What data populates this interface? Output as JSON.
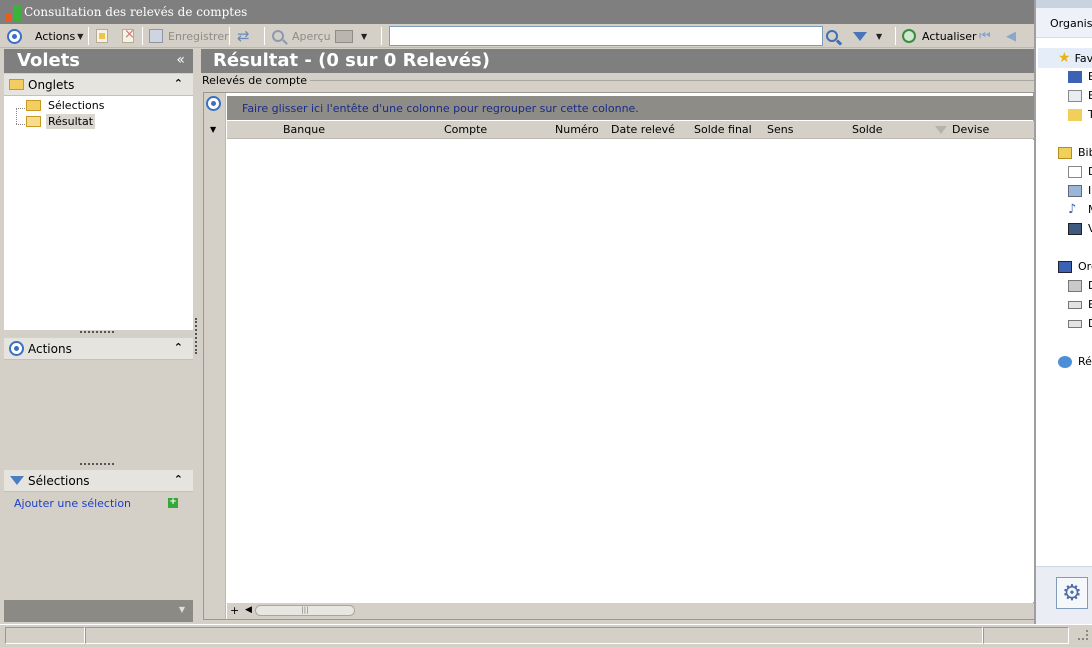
{
  "window": {
    "title": "Consultation des relevés de comptes"
  },
  "toolbar": {
    "actions_label": "Actions",
    "save_label": "Enregistrer",
    "preview_label": "Aperçu",
    "refresh_label": "Actualiser",
    "search_value": ""
  },
  "left": {
    "header_title": "Volets",
    "onglets": {
      "title": "Onglets",
      "items": [
        {
          "label": "Sélections"
        },
        {
          "label": "Résultat"
        }
      ]
    },
    "actions": {
      "title": "Actions"
    },
    "selections": {
      "title": "Sélections",
      "add_label": "Ajouter une sélection"
    }
  },
  "result": {
    "title": "Résultat - (0 sur 0 Relevés)",
    "group_label": "Relevés de compte",
    "group_hint": "Faire glisser ici l'entête d'une colonne pour regrouper sur cette colonne.",
    "columns": [
      "Banque",
      "Compte",
      "Numéro",
      "Date relevé",
      "Solde final",
      "Sens",
      "Solde",
      "Devise"
    ]
  },
  "explorer": {
    "organize_label": "Organiser",
    "items": [
      {
        "label": "Fav",
        "icon": "star-icon"
      },
      {
        "label": "B",
        "icon": "desktop-icon"
      },
      {
        "label": "E",
        "icon": "document-icon"
      },
      {
        "label": "T",
        "icon": "folder-icon"
      },
      {
        "label": "Bib",
        "icon": "library-icon"
      },
      {
        "label": "D",
        "icon": "document-icon"
      },
      {
        "label": "I",
        "icon": "picture-icon"
      },
      {
        "label": "M",
        "icon": "music-icon"
      },
      {
        "label": "V",
        "icon": "video-icon"
      },
      {
        "label": "Ord",
        "icon": "computer-icon"
      },
      {
        "label": "D",
        "icon": "drive-icon"
      },
      {
        "label": "E",
        "icon": "drive-icon"
      },
      {
        "label": "D",
        "icon": "drive-icon"
      },
      {
        "label": "Rés",
        "icon": "network-icon"
      }
    ]
  }
}
